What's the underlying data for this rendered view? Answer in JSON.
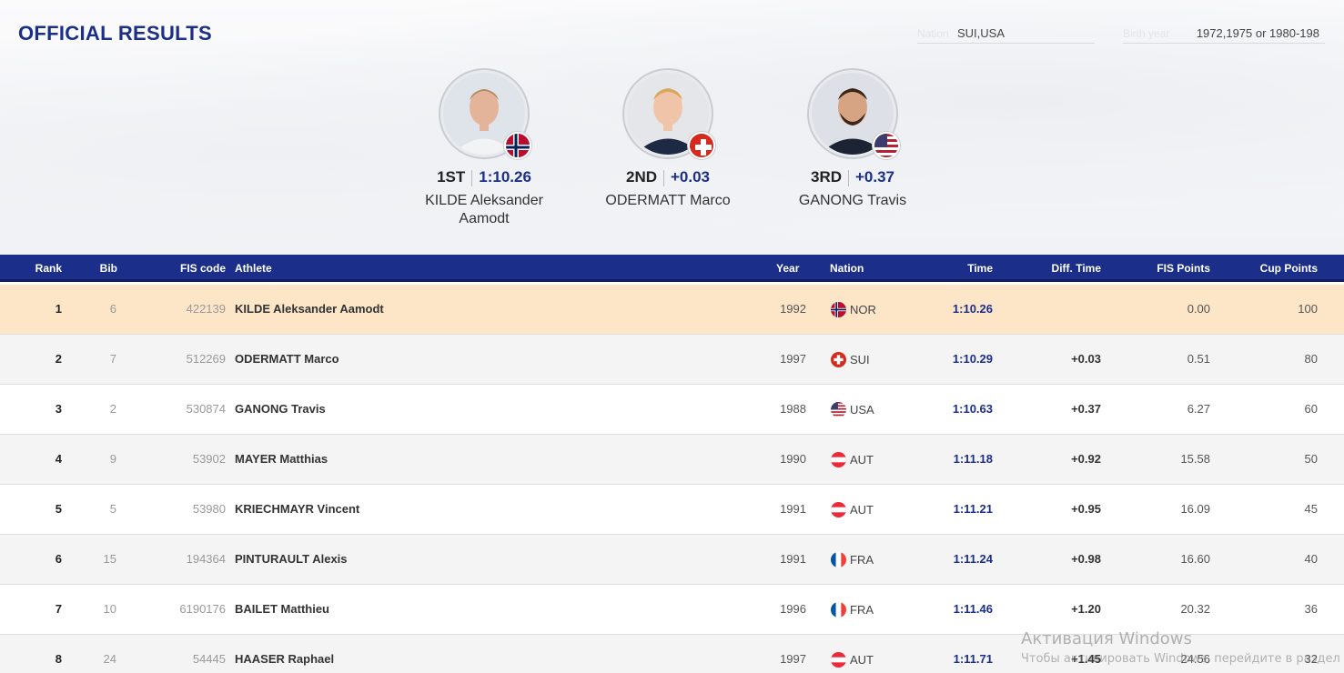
{
  "page": {
    "title": "OFFICIAL RESULTS"
  },
  "filters": {
    "nation": {
      "label": "Nation",
      "value": "SUI,USA"
    },
    "birth_year": {
      "label": "Birth year",
      "value": "1972,1975 or 1980-198"
    }
  },
  "podium": [
    {
      "place": "1ST",
      "time": "1:10.26",
      "name": "KILDE Aleksander Aamodt",
      "nation": "NOR"
    },
    {
      "place": "2ND",
      "time": "+0.03",
      "name": "ODERMATT Marco",
      "nation": "SUI"
    },
    {
      "place": "3RD",
      "time": "+0.37",
      "name": "GANONG Travis",
      "nation": "USA"
    }
  ],
  "table": {
    "headers": {
      "rank": "Rank",
      "bib": "Bib",
      "fis_code": "FIS code",
      "athlete": "Athlete",
      "year": "Year",
      "nation": "Nation",
      "time": "Time",
      "diff_time": "Diff. Time",
      "fis_points": "FIS Points",
      "cup_points": "Cup Points"
    },
    "rows": [
      {
        "rank": "1",
        "bib": "6",
        "fis_code": "422139",
        "athlete": "KILDE Aleksander Aamodt",
        "year": "1992",
        "nation": "NOR",
        "time": "1:10.26",
        "diff": "",
        "fis_points": "0.00",
        "cup_points": "100"
      },
      {
        "rank": "2",
        "bib": "7",
        "fis_code": "512269",
        "athlete": "ODERMATT Marco",
        "year": "1997",
        "nation": "SUI",
        "time": "1:10.29",
        "diff": "+0.03",
        "fis_points": "0.51",
        "cup_points": "80"
      },
      {
        "rank": "3",
        "bib": "2",
        "fis_code": "530874",
        "athlete": "GANONG Travis",
        "year": "1988",
        "nation": "USA",
        "time": "1:10.63",
        "diff": "+0.37",
        "fis_points": "6.27",
        "cup_points": "60"
      },
      {
        "rank": "4",
        "bib": "9",
        "fis_code": "53902",
        "athlete": "MAYER Matthias",
        "year": "1990",
        "nation": "AUT",
        "time": "1:11.18",
        "diff": "+0.92",
        "fis_points": "15.58",
        "cup_points": "50"
      },
      {
        "rank": "5",
        "bib": "5",
        "fis_code": "53980",
        "athlete": "KRIECHMAYR Vincent",
        "year": "1991",
        "nation": "AUT",
        "time": "1:11.21",
        "diff": "+0.95",
        "fis_points": "16.09",
        "cup_points": "45"
      },
      {
        "rank": "6",
        "bib": "15",
        "fis_code": "194364",
        "athlete": "PINTURAULT Alexis",
        "year": "1991",
        "nation": "FRA",
        "time": "1:11.24",
        "diff": "+0.98",
        "fis_points": "16.60",
        "cup_points": "40"
      },
      {
        "rank": "7",
        "bib": "10",
        "fis_code": "6190176",
        "athlete": "BAILET Matthieu",
        "year": "1996",
        "nation": "FRA",
        "time": "1:11.46",
        "diff": "+1.20",
        "fis_points": "20.32",
        "cup_points": "36"
      },
      {
        "rank": "8",
        "bib": "24",
        "fis_code": "54445",
        "athlete": "HAASER Raphael",
        "year": "1997",
        "nation": "AUT",
        "time": "1:11.71",
        "diff": "+1.45",
        "fis_points": "24.56",
        "cup_points": "32"
      }
    ]
  },
  "watermark": {
    "line1": "Активация Windows",
    "line2": "Чтобы активировать Windows, перейдите в раздел"
  },
  "colors": {
    "brand_blue": "#1b2f8a",
    "highlight_row": "#fde6c8",
    "alt_row": "#f4f4f4"
  }
}
